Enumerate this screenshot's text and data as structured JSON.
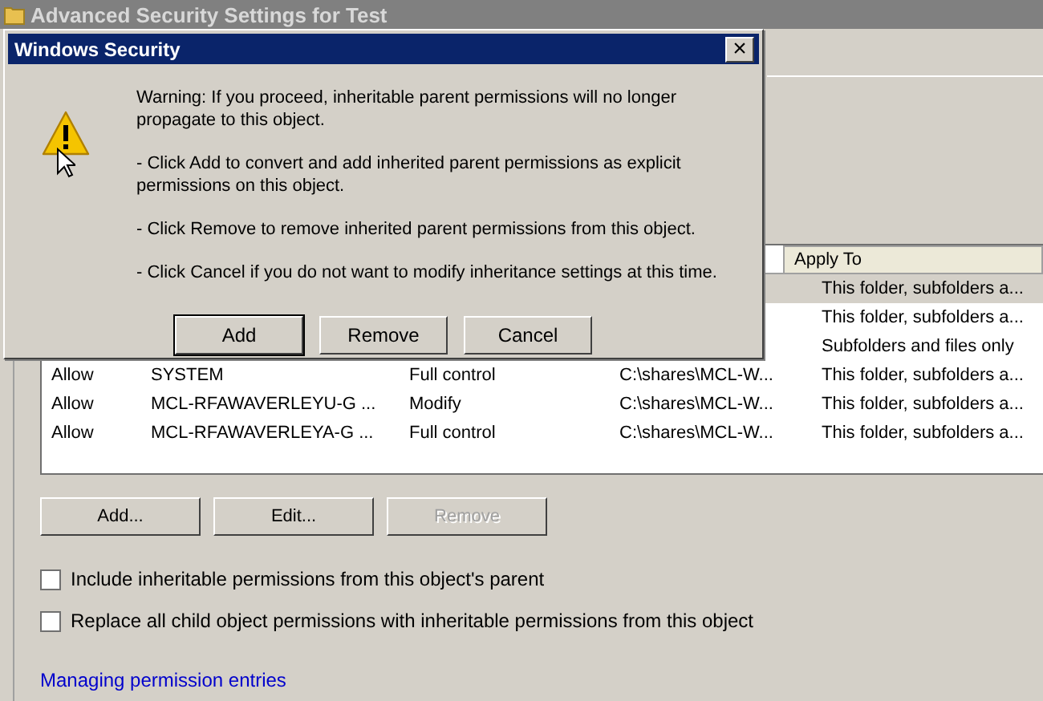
{
  "background_window": {
    "title": "Advanced Security Settings for Test"
  },
  "permissions_table": {
    "columns": [
      "Apply To"
    ],
    "rows": [
      {
        "apply_to": "This folder, subfolders a...",
        "selected": true
      },
      {
        "apply_to": "This folder, subfolders a...",
        "selected": false
      },
      {
        "apply_to": "Subfolders and files only",
        "selected": false
      },
      {
        "type": "Allow",
        "name": "SYSTEM",
        "permission": "Full control",
        "inherited_from": "C:\\shares\\MCL-W...",
        "apply_to": "This folder, subfolders a...",
        "selected": false
      },
      {
        "type": "Allow",
        "name": "MCL-RFAWAVERLEYU-G ...",
        "permission": "Modify",
        "inherited_from": "C:\\shares\\MCL-W...",
        "apply_to": "This folder, subfolders a...",
        "selected": false
      },
      {
        "type": "Allow",
        "name": "MCL-RFAWAVERLEYA-G ...",
        "permission": "Full control",
        "inherited_from": "C:\\shares\\MCL-W...",
        "apply_to": "This folder, subfolders a...",
        "selected": false
      }
    ]
  },
  "buttons": [
    {
      "label": "Add...",
      "disabled": false
    },
    {
      "label": "Edit...",
      "disabled": false
    },
    {
      "label": "Remove",
      "disabled": true
    }
  ],
  "checkboxes": [
    {
      "label": "Include inheritable permissions from this object's parent",
      "checked": false
    },
    {
      "label": "Replace all child object permissions with inheritable permissions from this object",
      "checked": false
    }
  ],
  "link": "Managing permission entries",
  "dialog": {
    "title": "Windows Security",
    "close": "×",
    "paragraphs": [
      "Warning: If you proceed, inheritable parent permissions will no longer propagate to this object.",
      "- Click Add to convert and add inherited parent permissions as explicit permissions on this object.",
      "- Click Remove to remove inherited parent permissions from this object.",
      "- Click Cancel if you do not want to modify inheritance settings at this time."
    ],
    "buttons": [
      {
        "label": "Add",
        "default": true
      },
      {
        "label": "Remove",
        "default": false
      },
      {
        "label": "Cancel",
        "default": false
      }
    ]
  }
}
